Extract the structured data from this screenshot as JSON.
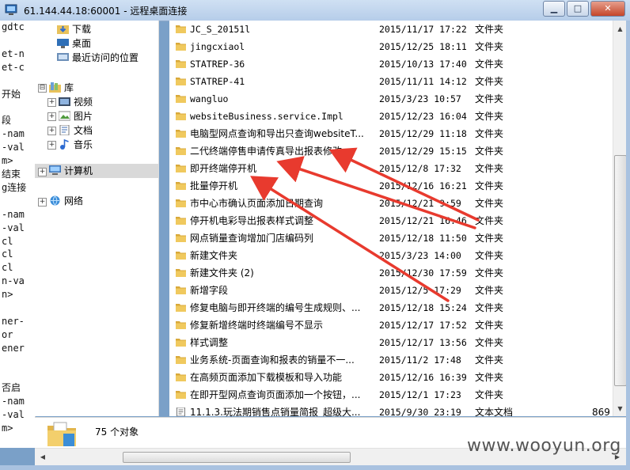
{
  "window": {
    "title": "61.144.44.18:60001 - 远程桌面连接",
    "minimize_label": "▁",
    "maximize_label": "□",
    "close_label": "✕"
  },
  "console_lines": [
    "gdtc",
    "",
    "et-n",
    "et-c",
    "",
    "开始",
    "",
    "段",
    "-nam",
    "-val",
    "m>",
    "结束",
    "g连接",
    "",
    "-nam",
    "-val",
    "cl",
    "cl",
    "cl",
    "n-va",
    "n>",
    "",
    "ner-",
    "or",
    "ener",
    "",
    "",
    "否启",
    "-nam",
    "-val",
    "m>"
  ],
  "nav": {
    "items": [
      {
        "label": "下载",
        "icon": "download-folder-icon"
      },
      {
        "label": "桌面",
        "icon": "desktop-icon"
      },
      {
        "label": "最近访问的位置",
        "icon": "recent-places-icon"
      },
      {
        "label": "库",
        "icon": "libraries-icon"
      },
      {
        "label": "视频",
        "icon": "videos-icon"
      },
      {
        "label": "图片",
        "icon": "pictures-icon"
      },
      {
        "label": "文档",
        "icon": "documents-icon"
      },
      {
        "label": "音乐",
        "icon": "music-icon"
      },
      {
        "label": "计算机",
        "icon": "computer-icon"
      },
      {
        "label": "网络",
        "icon": "network-icon"
      }
    ]
  },
  "files": [
    {
      "name": "JC_S_20151l",
      "date": "2015/11/17 17:22",
      "type": "文件夹",
      "size": ""
    },
    {
      "name": "jingcxiaol",
      "date": "2015/12/25 18:11",
      "type": "文件夹",
      "size": ""
    },
    {
      "name": "STATREP-36",
      "date": "2015/10/13 17:40",
      "type": "文件夹",
      "size": ""
    },
    {
      "name": "STATREP-41",
      "date": "2015/11/11 14:12",
      "type": "文件夹",
      "size": ""
    },
    {
      "name": "wangluo",
      "date": "2015/3/23 10:57",
      "type": "文件夹",
      "size": ""
    },
    {
      "name": "websiteBusiness.service.Impl",
      "date": "2015/12/23 16:04",
      "type": "文件夹",
      "size": ""
    },
    {
      "name": "电脑型网点查询和导出只查询websiteT...",
      "date": "2015/12/29 11:18",
      "type": "文件夹",
      "size": ""
    },
    {
      "name": "二代终端停售申请传真导出报表修改",
      "date": "2015/12/29 15:15",
      "type": "文件夹",
      "size": ""
    },
    {
      "name": "即开终端停开机",
      "date": "2015/12/8 17:32",
      "type": "文件夹",
      "size": ""
    },
    {
      "name": "批量停开机",
      "date": "2015/12/16 16:21",
      "type": "文件夹",
      "size": ""
    },
    {
      "name": "市中心市确认页面添加日期查询",
      "date": "2015/12/21 9:59",
      "type": "文件夹",
      "size": ""
    },
    {
      "name": "停开机电彩导出报表样式调整",
      "date": "2015/12/21 16:46",
      "type": "文件夹",
      "size": ""
    },
    {
      "name": "网点销量查询增加门店编码列",
      "date": "2015/12/18 11:50",
      "type": "文件夹",
      "size": ""
    },
    {
      "name": "新建文件夹",
      "date": "2015/3/23 14:00",
      "type": "文件夹",
      "size": ""
    },
    {
      "name": "新建文件夹 (2)",
      "date": "2015/12/30 17:59",
      "type": "文件夹",
      "size": ""
    },
    {
      "name": "新增字段",
      "date": "2015/12/5 17:29",
      "type": "文件夹",
      "size": ""
    },
    {
      "name": "修复电脑与即开终端的编号生成规则、...",
      "date": "2015/12/18 15:24",
      "type": "文件夹",
      "size": ""
    },
    {
      "name": "修复新增终端时终端编号不显示",
      "date": "2015/12/17 17:52",
      "type": "文件夹",
      "size": ""
    },
    {
      "name": "样式调整",
      "date": "2015/12/17 13:56",
      "type": "文件夹",
      "size": ""
    },
    {
      "name": "业务系统-页面查询和报表的销量不一...",
      "date": "2015/11/2 17:48",
      "type": "文件夹",
      "size": ""
    },
    {
      "name": "在高频页面添加下载模板和导入功能",
      "date": "2015/12/16 16:39",
      "type": "文件夹",
      "size": ""
    },
    {
      "name": "在即开型网点查询页面添加一个按钮，...",
      "date": "2015/12/1 17:23",
      "type": "文件夹",
      "size": ""
    },
    {
      "name": "11.1.3.玩法期销售点销量简报_超级大...",
      "date": "2015/9/30 23:19",
      "type": "文本文档",
      "size": "869"
    }
  ],
  "details": {
    "count_label": "75 个对象"
  },
  "watermark": "www.wooyun.org",
  "colors": {
    "annotation_arrow": "#e83a2e",
    "folder": "#e8c25c",
    "selection": "#d9d9d9"
  }
}
